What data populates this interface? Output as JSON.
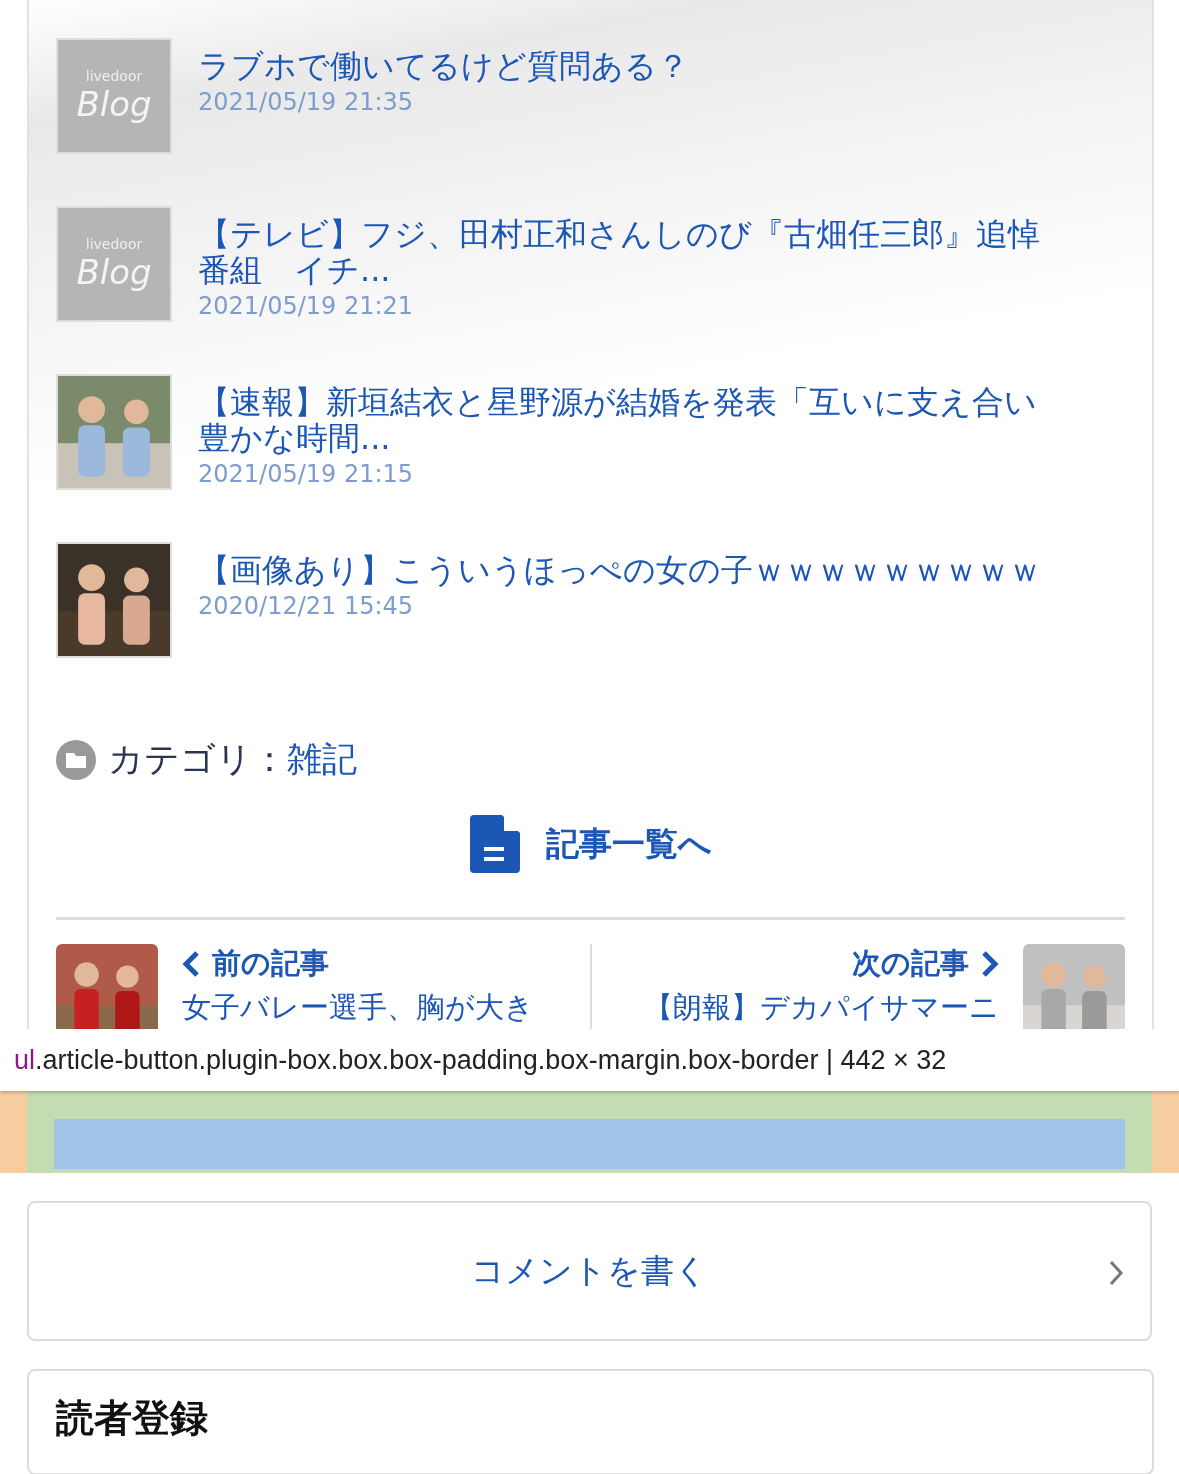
{
  "related_articles": [
    {
      "title": "ラブホで働いてるけど質問ある？",
      "date": "2021/05/19 21:35",
      "thumb": {
        "kind": "blog_logo",
        "top": "livedoor",
        "main": "Blog"
      }
    },
    {
      "title": "【テレビ】フジ、田村正和さんしのび『古畑任三郎』追悼番組　イチ...",
      "date": "2021/05/19 21:21",
      "thumb": {
        "kind": "blog_logo",
        "top": "livedoor",
        "main": "Blog"
      }
    },
    {
      "title": "【速報】新垣結衣と星野源が結婚を発表「互いに支え合い豊かな時間...",
      "date": "2021/05/19 21:15"
    },
    {
      "title": "【画像あり】こういうほっぺの女の子ｗｗｗｗｗｗｗｗｗ",
      "date": "2020/12/21 15:45"
    }
  ],
  "category": {
    "label": "カテゴリ：",
    "value": "雑記"
  },
  "article_list_link": "記事一覧へ",
  "prev_article": {
    "label": "前の記事",
    "title": "女子バレー選手、胸が大き"
  },
  "next_article": {
    "label": "次の記事",
    "title": "【朗報】デカパイサマーニ"
  },
  "inspector_tooltip": {
    "tag": "ul",
    "classes": ".article-button.plugin-box.box.box-padding.box-margin.box-border",
    "size": " | 442 × 32"
  },
  "comment_button": "コメントを書く",
  "reader_registration": {
    "title": "読者登録"
  }
}
